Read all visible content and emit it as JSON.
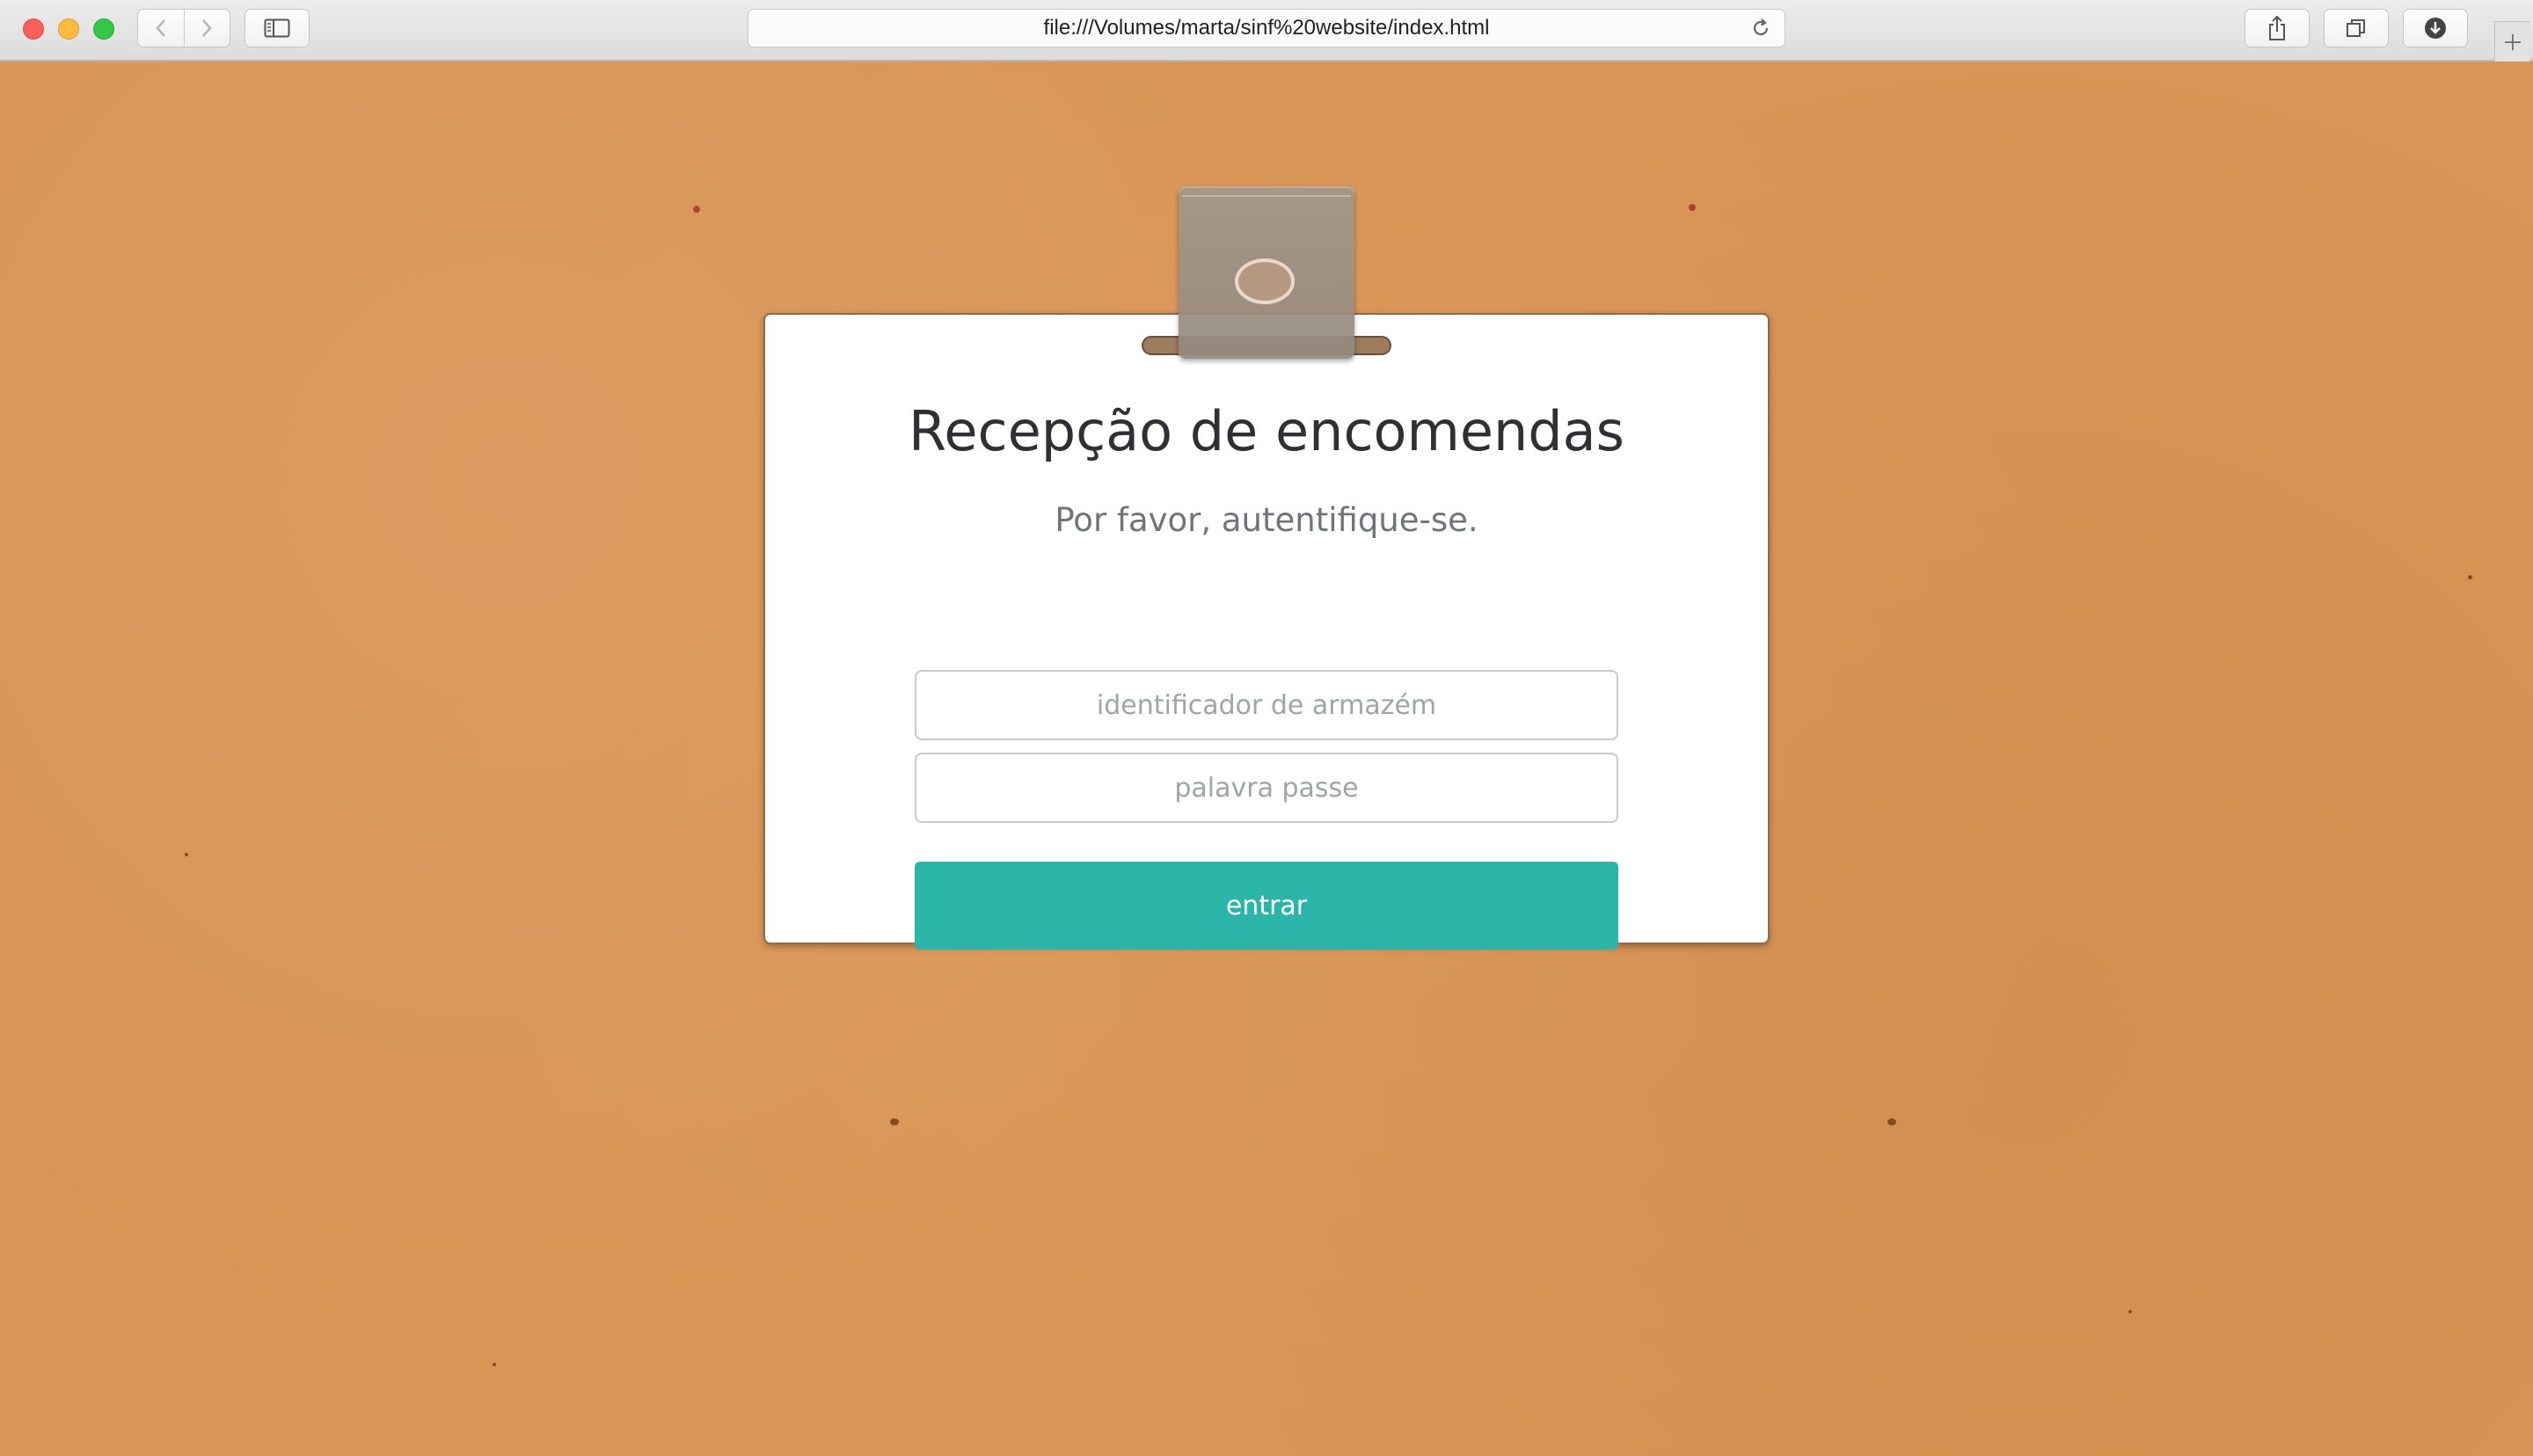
{
  "browser": {
    "url": "file:///Volumes/marta/sinf%20website/index.html",
    "icons": {
      "back": "chevron-left-icon",
      "forward": "chevron-right-icon",
      "sidebar": "sidebar-icon",
      "reload": "reload-icon",
      "share": "share-icon",
      "tabs": "tabs-overview-icon",
      "downloads": "download-icon",
      "new_tab": "plus-icon"
    }
  },
  "login": {
    "title": "Recepção de encomendas",
    "subtitle": "Por favor, autentifique-se.",
    "warehouse_id": {
      "value": "",
      "placeholder": "identificador de armazém"
    },
    "password": {
      "value": "",
      "placeholder": "palavra passe"
    },
    "submit_label": "entrar"
  },
  "colors": {
    "background": "#d99556",
    "accent": "#2bb5a8",
    "card": "#ffffff",
    "title_text": "#2f3035",
    "subtitle_text": "#6f737a"
  }
}
